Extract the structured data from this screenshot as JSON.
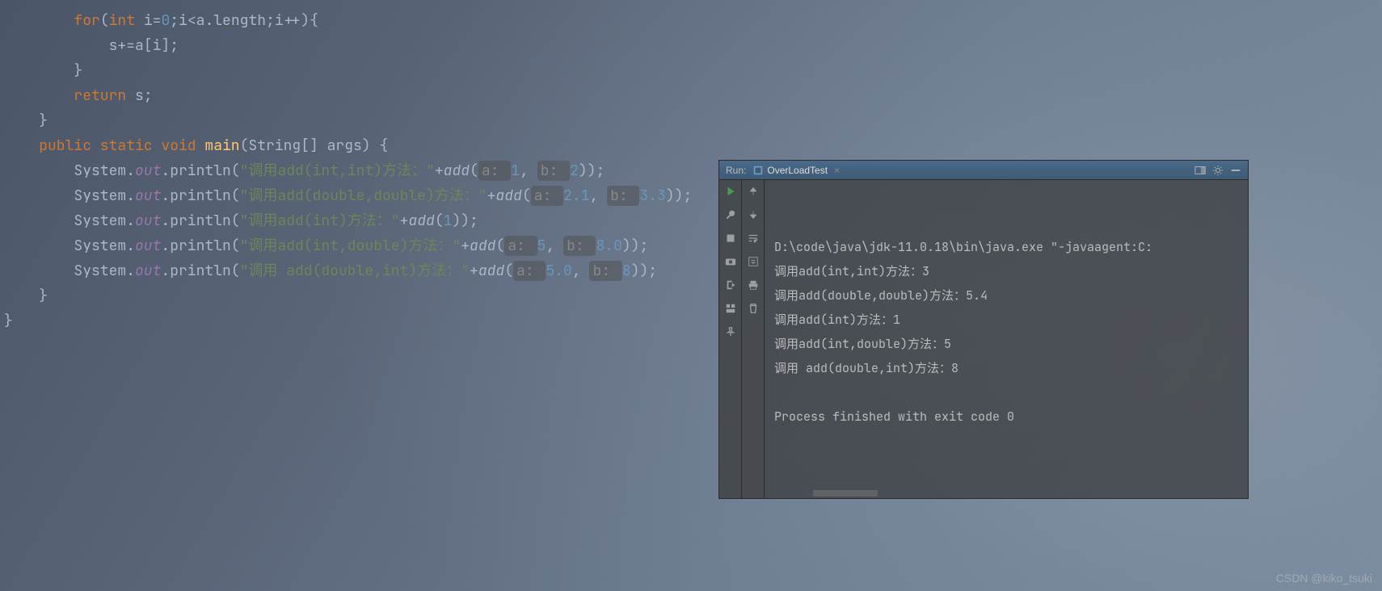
{
  "editor": {
    "lines": [
      {
        "indent": "        ",
        "tokens": [
          [
            "kw",
            "for"
          ],
          [
            "",
            ""
          ],
          [
            "",
            "("
          ],
          [
            "kw",
            "int "
          ],
          [
            "",
            "i="
          ],
          [
            "num",
            "0"
          ],
          [
            "",
            ";i<a."
          ],
          [
            "under",
            "length"
          ],
          [
            "",
            ";i++){"
          ]
        ]
      },
      {
        "indent": "            ",
        "tokens": [
          [
            "under",
            "s"
          ],
          [
            "",
            "+=a[i];"
          ]
        ]
      },
      {
        "indent": "        ",
        "tokens": [
          [
            "",
            "}"
          ]
        ]
      },
      {
        "indent": "        ",
        "tokens": [
          [
            "kw",
            "return "
          ],
          [
            "under",
            "s"
          ],
          [
            "",
            ";"
          ]
        ]
      },
      {
        "indent": "    ",
        "tokens": [
          [
            "",
            "}"
          ]
        ]
      },
      {
        "indent": "",
        "tokens": [
          [
            "",
            ""
          ]
        ]
      },
      {
        "indent": "    ",
        "tokens": [
          [
            "kw",
            "public static "
          ],
          [
            "kw",
            "void "
          ],
          [
            "fn",
            "main"
          ],
          [
            "",
            "(String[] args) {"
          ]
        ]
      },
      {
        "indent": "        ",
        "tokens": [
          [
            "",
            "System."
          ],
          [
            "field",
            "out"
          ],
          [
            "",
            ".println("
          ],
          [
            "str",
            "\"调用add(int,int)方法："
          ],
          [
            "str",
            "\""
          ],
          [
            "",
            "+"
          ],
          [
            "ital",
            "add"
          ],
          [
            "",
            "("
          ],
          [
            "hint",
            "a: "
          ],
          [
            "num",
            "1"
          ],
          [
            "",
            ", "
          ],
          [
            "hint",
            "b: "
          ],
          [
            "num",
            "2"
          ],
          [
            "",
            "));"
          ]
        ]
      },
      {
        "indent": "        ",
        "tokens": [
          [
            "",
            "System."
          ],
          [
            "field",
            "out"
          ],
          [
            "",
            ".println("
          ],
          [
            "str",
            "\"调用add(double,double)方法：\""
          ],
          [
            "",
            "+"
          ],
          [
            "ital",
            "add"
          ],
          [
            "",
            "("
          ],
          [
            "hint",
            "a: "
          ],
          [
            "num",
            "2.1"
          ],
          [
            "",
            ", "
          ],
          [
            "hint",
            "b: "
          ],
          [
            "num",
            "3.3"
          ],
          [
            "",
            "));"
          ]
        ]
      },
      {
        "indent": "        ",
        "tokens": [
          [
            "",
            "System."
          ],
          [
            "field",
            "out"
          ],
          [
            "",
            ".println("
          ],
          [
            "str",
            "\"调用add(int)方法：\""
          ],
          [
            "",
            "+"
          ],
          [
            "ital",
            "add"
          ],
          [
            "",
            "("
          ],
          [
            "num",
            "1"
          ],
          [
            "",
            "));"
          ]
        ]
      },
      {
        "indent": "        ",
        "tokens": [
          [
            "",
            "System."
          ],
          [
            "field",
            "out"
          ],
          [
            "",
            ".println("
          ],
          [
            "str",
            "\"调用add(int,double)方法：\""
          ],
          [
            "",
            "+"
          ],
          [
            "ital",
            "add"
          ],
          [
            "",
            "("
          ],
          [
            "hint",
            "a: "
          ],
          [
            "num",
            "5"
          ],
          [
            "",
            ", "
          ],
          [
            "hint",
            "b: "
          ],
          [
            "num",
            "8.0"
          ],
          [
            "",
            "));"
          ]
        ]
      },
      {
        "indent": "        ",
        "tokens": [
          [
            "",
            "System."
          ],
          [
            "field",
            "out"
          ],
          [
            "",
            ".println("
          ],
          [
            "str",
            "\"调用 add(double,int)方法：\""
          ],
          [
            "",
            "+"
          ],
          [
            "ital",
            "add"
          ],
          [
            "",
            "("
          ],
          [
            "hint",
            "a: "
          ],
          [
            "num",
            "5.0"
          ],
          [
            "",
            ", "
          ],
          [
            "hint",
            "b: "
          ],
          [
            "num",
            "8"
          ],
          [
            "",
            "));"
          ]
        ]
      },
      {
        "indent": "",
        "tokens": [
          [
            "",
            ""
          ]
        ]
      },
      {
        "indent": "    ",
        "tokens": [
          [
            "",
            "}"
          ]
        ]
      },
      {
        "indent": "",
        "tokens": [
          [
            "",
            "}"
          ]
        ]
      }
    ]
  },
  "run": {
    "label": "Run:",
    "tab_name": "OverLoadTest",
    "close_x": "×",
    "output": [
      "D:\\code\\java\\jdk-11.0.18\\bin\\java.exe \"-javaagent:C:",
      "调用add(int,int)方法：3",
      "调用add(double,double)方法：5.4",
      "调用add(int)方法：1",
      "调用add(int,double)方法：5",
      "调用 add(double,int)方法：8",
      "",
      "Process finished with exit code 0"
    ]
  },
  "watermark": "CSDN @kiko_tsuki"
}
